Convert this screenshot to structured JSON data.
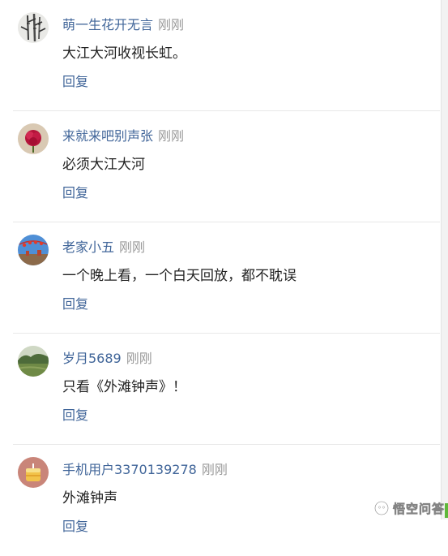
{
  "comments": [
    {
      "username": "萌一生花开无言",
      "time": "刚刚",
      "text": "大江大河收视长虹。",
      "reply_label": "回复",
      "avatar": "bamboo-ink-avatar"
    },
    {
      "username": "来就来吧别声张",
      "time": "刚刚",
      "text": "必须大江大河",
      "reply_label": "回复",
      "avatar": "red-flower-avatar"
    },
    {
      "username": "老家小五",
      "time": "刚刚",
      "text": "一个晚上看，一个白天回放，都不耽误",
      "reply_label": "回复",
      "avatar": "lantern-sky-avatar"
    },
    {
      "username": "岁月5689",
      "time": "刚刚",
      "text": "只看《外滩钟声》！",
      "reply_label": "回复",
      "avatar": "landscape-avatar"
    },
    {
      "username": "手机用户3370139278",
      "time": "刚刚",
      "text": "外滩钟声",
      "reply_label": "回复",
      "avatar": "cake-avatar"
    }
  ],
  "watermark": {
    "text": "悟空问答",
    "icon": "wukong-logo-icon"
  },
  "colors": {
    "username": "#406599",
    "time": "#999999",
    "body_text": "#222222",
    "reply": "#406599",
    "divider": "#e8e8e8"
  }
}
